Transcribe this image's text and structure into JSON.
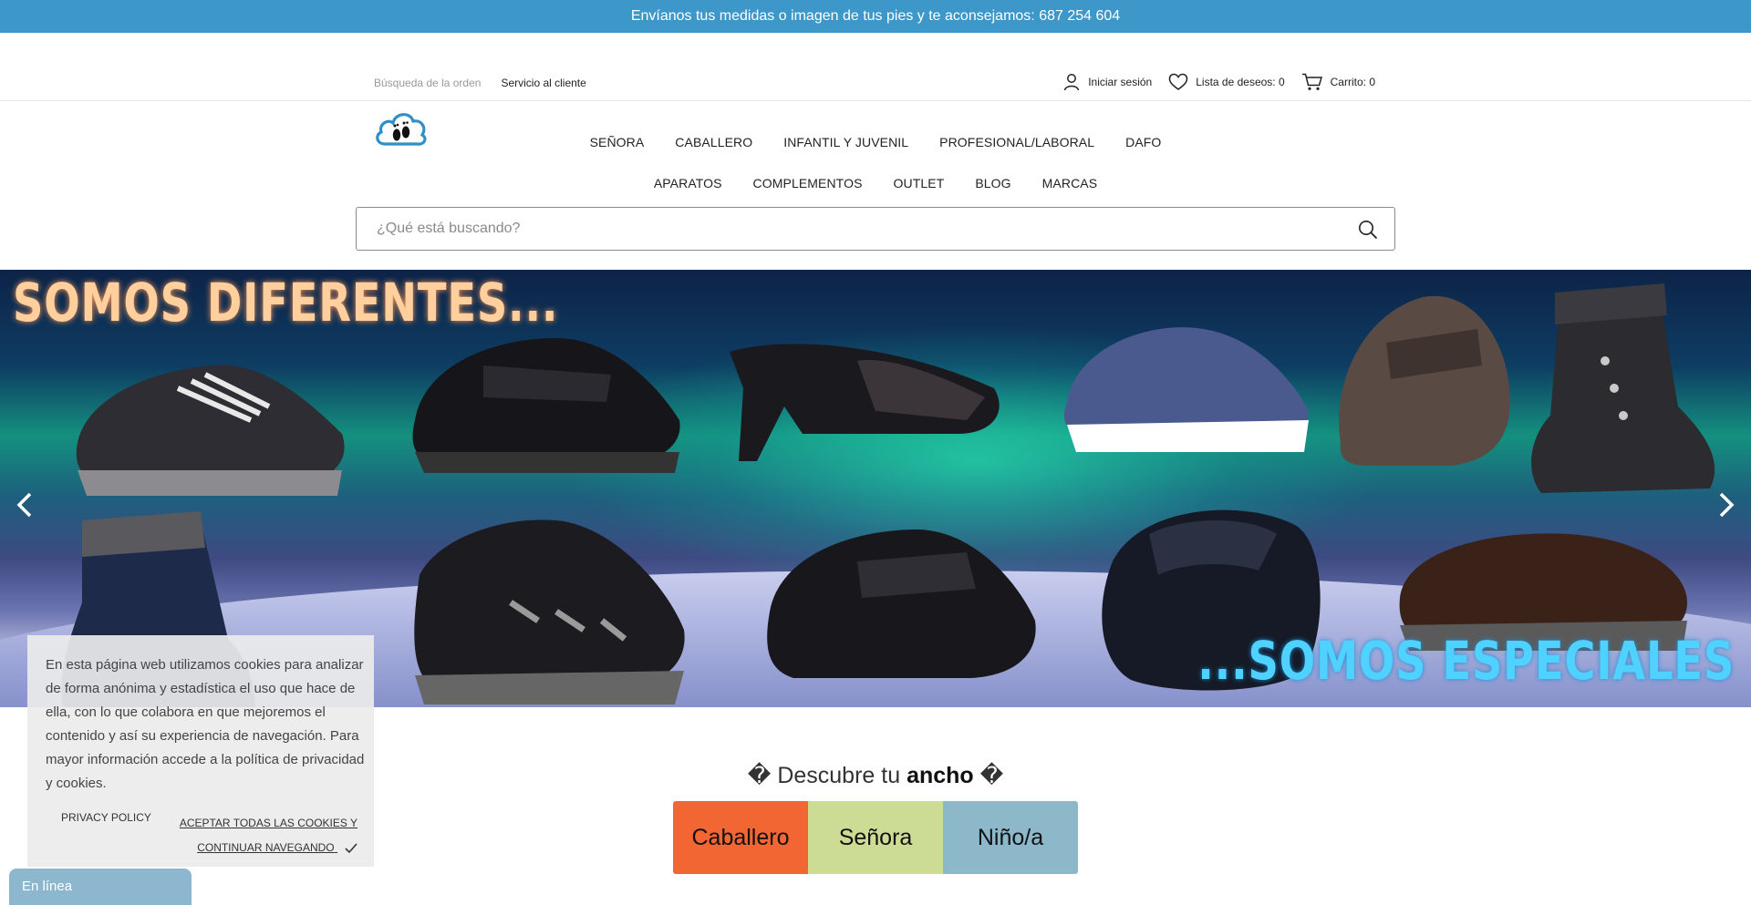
{
  "topbar": {
    "text": "Envíanos tus medidas o imagen de tus pies y te aconsejamos: 687 254 604"
  },
  "utility": {
    "order_search": "Búsqueda de la orden",
    "customer_service": "Servicio al cliente",
    "login": "Iniciar sesión",
    "wishlist": "Lista de deseos: 0",
    "cart": "Carrito: 0"
  },
  "nav": {
    "row1": [
      "SEÑORA",
      "CABALLERO",
      "INFANTIL Y JUVENIL",
      "PROFESIONAL/LABORAL",
      "DAFO"
    ],
    "row2": [
      "APARATOS",
      "COMPLEMENTOS",
      "OUTLET",
      "BLOG",
      "MARCAS"
    ]
  },
  "search": {
    "placeholder": "¿Qué está buscando?"
  },
  "hero": {
    "headline_left": "SOMOS DIFERENTES...",
    "headline_right": "...SOMOS ESPECIALES"
  },
  "discover": {
    "prefix": "Descubre tu",
    "bold": "ancho",
    "glyph": "�"
  },
  "tiles": [
    {
      "label": "Caballero",
      "color": "#f26633"
    },
    {
      "label": "Señora",
      "color": "#cddc94"
    },
    {
      "label": "Niño/a",
      "color": "#8cb8ca"
    }
  ],
  "cookie": {
    "message": "En esta página web utilizamos cookies para analizar de forma anónima y estadística el uso que hace de ella, con lo que colabora en que mejoremos el contenido y así su experiencia de navegación. Para mayor información accede a la política de privacidad y cookies.",
    "privacy": "PRIVACY POLICY",
    "accept_line1": "ACEPTAR TODAS LAS COOKIES Y",
    "accept_line2": "CONTINUAR NAVEGANDO"
  },
  "chat": {
    "label": "En línea"
  },
  "colors": {
    "topbar": "#3d97c9",
    "accent_orange": "#f26633",
    "accent_green": "#cddc94",
    "accent_blue": "#8cb8ca"
  }
}
